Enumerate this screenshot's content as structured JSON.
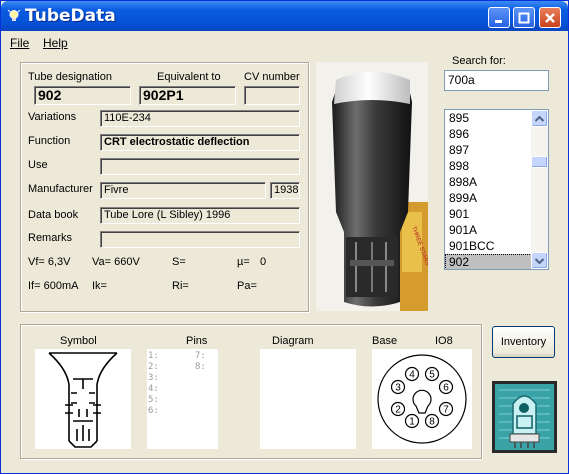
{
  "window": {
    "title": "TubeData"
  },
  "menu": {
    "file": "File",
    "help": "Help"
  },
  "tube": {
    "designation_label": "Tube designation",
    "designation_value": "902",
    "equivalent_label": "Equivalent to",
    "equivalent_value": "902P1",
    "cv_label": "CV number",
    "cv_value": "",
    "variations_label": "Variations",
    "variations_value": "110E-234",
    "function_label": "Function",
    "function_value": "CRT electrostatic deflection",
    "use_label": "Use",
    "use_value": "",
    "manufacturer_label": "Manufacturer",
    "manufacturer_value": "Fivre",
    "year_value": "1938",
    "databook_label": "Data book",
    "databook_value": "Tube Lore (L Sibley) 1996",
    "remarks_label": "Remarks",
    "remarks_value": "",
    "params": {
      "vf": "Vf= 6,3V",
      "va": "Va= 660V",
      "s": "S=",
      "mu": "µ=",
      "mu_val": "0",
      "if": "If= 600mA",
      "ik": "Ik=",
      "ri": "Ri=",
      "pa": "Pa="
    }
  },
  "search": {
    "label": "Search for:",
    "value": "700a"
  },
  "list": {
    "items": [
      "895",
      "896",
      "897",
      "898",
      "898A",
      "899A",
      "901",
      "901A",
      "901BCC",
      "902"
    ],
    "selected": "902"
  },
  "bottom": {
    "symbol_label": "Symbol",
    "pins_label": "Pins",
    "diagram_label": "Diagram",
    "base_label": "Base",
    "base_type": "IO8",
    "pins_left": [
      "1:",
      "2:",
      "3:",
      "4:",
      "5:",
      "6:"
    ],
    "pins_right": [
      "7:",
      "8:"
    ],
    "base_pins": [
      "1",
      "2",
      "3",
      "4",
      "5",
      "6",
      "7",
      "8"
    ]
  },
  "buttons": {
    "inventory": "Inventory"
  },
  "photo_label": "THREE STARS"
}
